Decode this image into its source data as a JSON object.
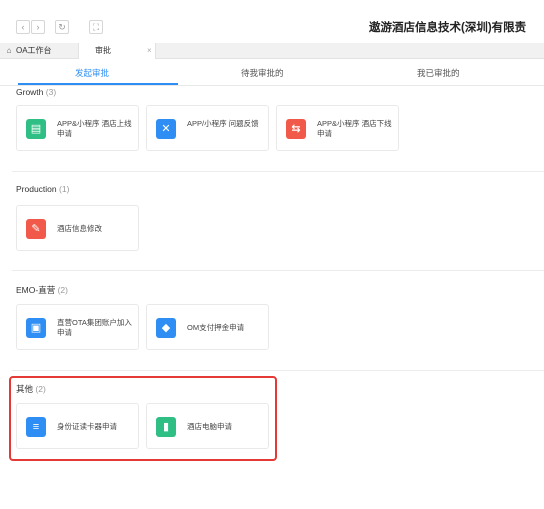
{
  "toolbar": {
    "back_icon": "chevron-left-icon",
    "forward_icon": "chevron-right-icon",
    "refresh_icon": "refresh-icon",
    "fullscreen_icon": "fullscreen-icon",
    "company_name": "遨游酒店信息技术(深圳)有限责",
    "company_caret": "▾"
  },
  "tabs": [
    {
      "label": "OA工作台",
      "icon": "home-icon"
    },
    {
      "label": "审批",
      "close": "×"
    }
  ],
  "subtabs": [
    {
      "label": "发起审批",
      "active": true
    },
    {
      "label": "待我审批的",
      "active": false
    },
    {
      "label": "我已审批的",
      "active": false
    }
  ],
  "sections": [
    {
      "title": "Growth",
      "count": "(3)",
      "cards": [
        {
          "label": "APP&小程序 酒店上线申请",
          "icon": "clipboard-icon",
          "color": "#2fbf84"
        },
        {
          "label": "APP/小程序 问题反馈",
          "icon": "tools-icon",
          "color": "#2f8ef4"
        },
        {
          "label": "APP&小程序 酒店下线申请",
          "icon": "swap-icon",
          "color": "#f15a4a"
        }
      ]
    },
    {
      "title": "Production",
      "count": "(1)",
      "cards": [
        {
          "label": "酒店信息修改",
          "icon": "document-edit-icon",
          "color": "#f15a4a"
        }
      ]
    },
    {
      "title": "EMO-直营",
      "count": "(2)",
      "cards": [
        {
          "label": "直营OTA集团账户加入申请",
          "icon": "briefcase-icon",
          "color": "#2f8ef4"
        },
        {
          "label": "OM支付押金申请",
          "icon": "diamond-icon",
          "color": "#2f8ef4"
        }
      ]
    },
    {
      "title": "其他",
      "count": "(2)",
      "cards": [
        {
          "label": "身份证读卡器申请",
          "icon": "id-card-icon",
          "color": "#2f8ef4"
        },
        {
          "label": "酒店电脑申请",
          "icon": "document-icon",
          "color": "#2fbf84"
        }
      ]
    }
  ]
}
